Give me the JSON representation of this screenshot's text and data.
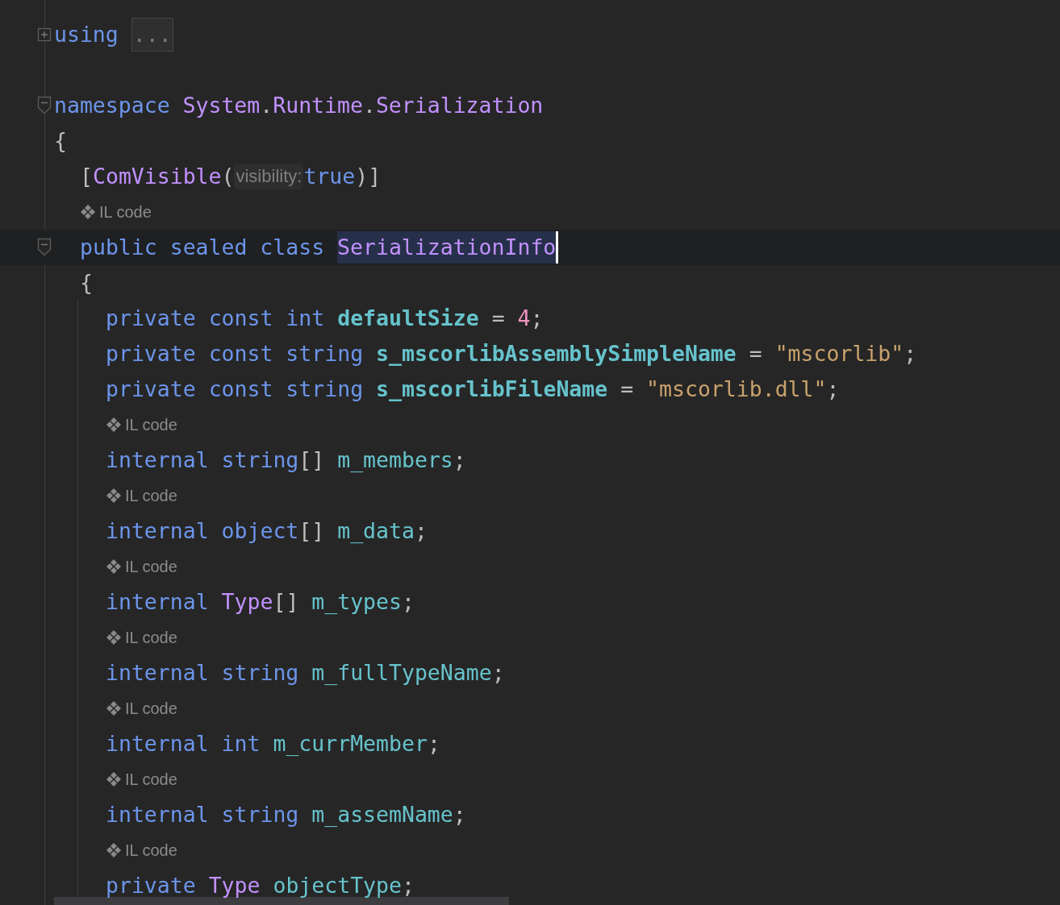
{
  "editor": {
    "lines": [
      {
        "kind": "code",
        "expanded": false,
        "tokens": [
          {
            "kind": "kw",
            "text": "using "
          },
          {
            "kind": "fold",
            "text": "..."
          }
        ]
      },
      {
        "kind": "blank"
      },
      {
        "kind": "code",
        "expanded": true,
        "tokens": [
          {
            "kind": "kw",
            "text": "namespace "
          },
          {
            "kind": "type",
            "text": "System"
          },
          {
            "kind": "plain",
            "text": "."
          },
          {
            "kind": "type",
            "text": "Runtime"
          },
          {
            "kind": "plain",
            "text": "."
          },
          {
            "kind": "type",
            "text": "Serialization"
          }
        ]
      },
      {
        "kind": "code",
        "tokens": [
          {
            "kind": "plain",
            "text": "{"
          }
        ],
        "children": [
          {
            "kind": "code",
            "tokens": [
              {
                "kind": "plain",
                "text": "["
              },
              {
                "kind": "type",
                "text": "ComVisible"
              },
              {
                "kind": "plain",
                "text": "("
              },
              {
                "kind": "param",
                "text": "visibility:"
              },
              {
                "kind": "kw",
                "text": "true"
              },
              {
                "kind": "plain",
                "text": ")]"
              }
            ]
          },
          {
            "kind": "hint",
            "text": "IL code"
          },
          {
            "kind": "code",
            "expanded": true,
            "current": true,
            "caret": true,
            "tokens": [
              {
                "kind": "kw",
                "text": "public sealed class "
              },
              {
                "kind": "type",
                "text": "SerializationInfo",
                "highlighted": true
              }
            ]
          },
          {
            "kind": "code",
            "tokens": [
              {
                "kind": "plain",
                "text": "{"
              }
            ],
            "children": [
              {
                "kind": "code",
                "tokens": [
                  {
                    "kind": "kw",
                    "text": "private const int "
                  },
                  {
                    "kind": "field",
                    "text": "defaultSize",
                    "bold": true
                  },
                  {
                    "kind": "plain",
                    "text": " = "
                  },
                  {
                    "kind": "num",
                    "text": "4"
                  },
                  {
                    "kind": "plain",
                    "text": ";"
                  }
                ]
              },
              {
                "kind": "code",
                "tokens": [
                  {
                    "kind": "kw",
                    "text": "private const string "
                  },
                  {
                    "kind": "field",
                    "text": "s_mscorlibAssemblySimpleName",
                    "bold": true
                  },
                  {
                    "kind": "plain",
                    "text": " = "
                  },
                  {
                    "kind": "str",
                    "text": "\"mscorlib\""
                  },
                  {
                    "kind": "plain",
                    "text": ";"
                  }
                ]
              },
              {
                "kind": "code",
                "tokens": [
                  {
                    "kind": "kw",
                    "text": "private const string "
                  },
                  {
                    "kind": "field",
                    "text": "s_mscorlibFileName",
                    "bold": true
                  },
                  {
                    "kind": "plain",
                    "text": " = "
                  },
                  {
                    "kind": "str",
                    "text": "\"mscorlib.dll\""
                  },
                  {
                    "kind": "plain",
                    "text": ";"
                  }
                ]
              },
              {
                "kind": "hint",
                "text": "IL code"
              },
              {
                "kind": "code",
                "tokens": [
                  {
                    "kind": "kw",
                    "text": "internal string"
                  },
                  {
                    "kind": "plain",
                    "text": "[] "
                  },
                  {
                    "kind": "field",
                    "text": "m_members"
                  },
                  {
                    "kind": "plain",
                    "text": ";"
                  }
                ]
              },
              {
                "kind": "hint",
                "text": "IL code"
              },
              {
                "kind": "code",
                "tokens": [
                  {
                    "kind": "kw",
                    "text": "internal object"
                  },
                  {
                    "kind": "plain",
                    "text": "[] "
                  },
                  {
                    "kind": "field",
                    "text": "m_data"
                  },
                  {
                    "kind": "plain",
                    "text": ";"
                  }
                ]
              },
              {
                "kind": "hint",
                "text": "IL code"
              },
              {
                "kind": "code",
                "tokens": [
                  {
                    "kind": "kw",
                    "text": "internal "
                  },
                  {
                    "kind": "type",
                    "text": "Type"
                  },
                  {
                    "kind": "plain",
                    "text": "[] "
                  },
                  {
                    "kind": "field",
                    "text": "m_types"
                  },
                  {
                    "kind": "plain",
                    "text": ";"
                  }
                ]
              },
              {
                "kind": "hint",
                "text": "IL code"
              },
              {
                "kind": "code",
                "tokens": [
                  {
                    "kind": "kw",
                    "text": "internal string "
                  },
                  {
                    "kind": "field",
                    "text": "m_fullTypeName"
                  },
                  {
                    "kind": "plain",
                    "text": ";"
                  }
                ]
              },
              {
                "kind": "hint",
                "text": "IL code"
              },
              {
                "kind": "code",
                "tokens": [
                  {
                    "kind": "kw",
                    "text": "internal int "
                  },
                  {
                    "kind": "field",
                    "text": "m_currMember"
                  },
                  {
                    "kind": "plain",
                    "text": ";"
                  }
                ]
              },
              {
                "kind": "hint",
                "text": "IL code"
              },
              {
                "kind": "code",
                "tokens": [
                  {
                    "kind": "kw",
                    "text": "internal string "
                  },
                  {
                    "kind": "field",
                    "text": "m_assemName"
                  },
                  {
                    "kind": "plain",
                    "text": ";"
                  }
                ]
              },
              {
                "kind": "hint",
                "text": "IL code"
              },
              {
                "kind": "code",
                "tokens": [
                  {
                    "kind": "kw",
                    "text": "private "
                  },
                  {
                    "kind": "type",
                    "text": "Type "
                  },
                  {
                    "kind": "field",
                    "text": "objectType"
                  },
                  {
                    "kind": "plain",
                    "text": ";"
                  }
                ]
              }
            ]
          }
        ]
      }
    ]
  }
}
